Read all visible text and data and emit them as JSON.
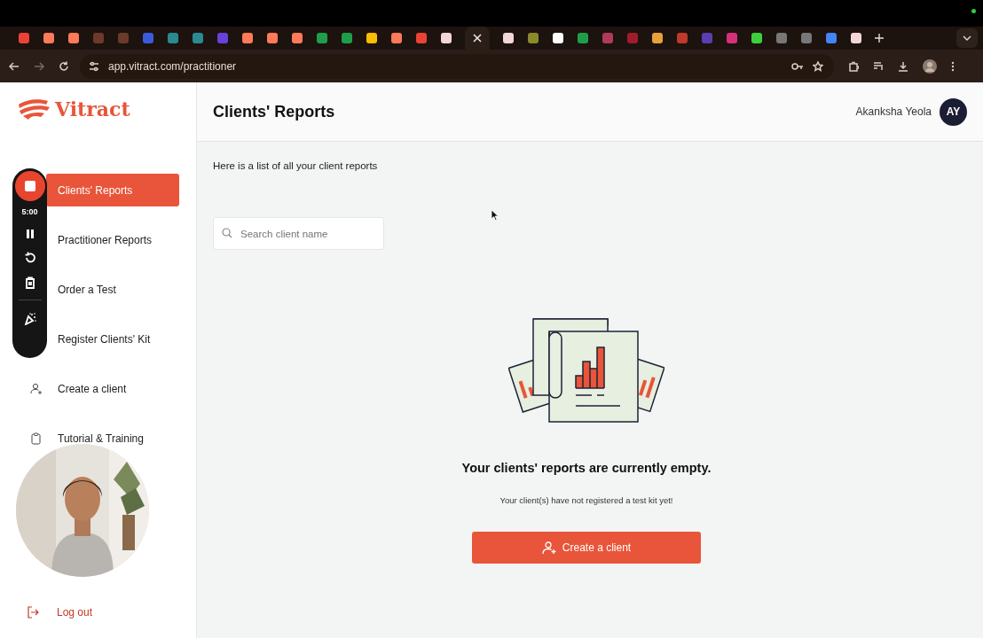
{
  "browser": {
    "url": "app.vitract.com/practitioner"
  },
  "sidebar": {
    "logo": "Vitract",
    "items": [
      {
        "label": "Clients' Reports",
        "selected": true
      },
      {
        "label": "Practitioner Reports",
        "selected": false
      },
      {
        "label": "Order a Test",
        "selected": false
      },
      {
        "label": "Register Clients' Kit",
        "selected": false
      },
      {
        "label": "Create a client",
        "selected": false
      },
      {
        "label": "Tutorial & Training",
        "selected": false
      }
    ],
    "logout": "Log out"
  },
  "recorder": {
    "time": "5:00"
  },
  "header": {
    "title": "Clients' Reports",
    "user": "Akanksha Yeola",
    "initials": "AY"
  },
  "intro": "Here is a list of all your client reports",
  "search": {
    "placeholder": "Search client name"
  },
  "empty": {
    "title": "Your clients' reports are currently empty.",
    "message": "Your client(s) have not registered a test kit yet!",
    "button": "Create a client"
  }
}
